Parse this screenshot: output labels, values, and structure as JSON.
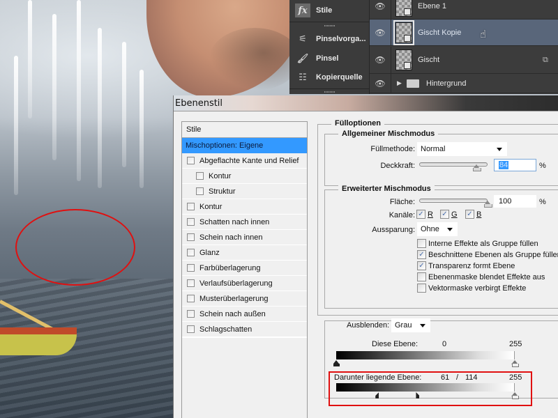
{
  "canvas": {
    "description": "Photo composition: face close-up above stormy sea with water spray and a fishing boat",
    "annotation": "red ellipse highlighting bright spray on water"
  },
  "dock_panels": [
    {
      "label": "Stile",
      "icon": "fx-styles-icon"
    },
    {
      "label": "Pinselvorga...",
      "icon": "brush-presets-icon"
    },
    {
      "label": "Pinsel",
      "icon": "brush-icon"
    },
    {
      "label": "Kopierquelle",
      "icon": "clone-source-icon"
    }
  ],
  "layers": [
    {
      "name": "Ebene 1",
      "visible": true,
      "selected": false,
      "type": "layer"
    },
    {
      "name": "Gischt Kopie",
      "visible": false,
      "selected": true,
      "type": "layer"
    },
    {
      "name": "Gischt",
      "visible": true,
      "selected": false,
      "type": "layer",
      "badge": "smart-object-icon"
    },
    {
      "name": "Hintergrund",
      "visible": true,
      "selected": false,
      "type": "group"
    }
  ],
  "dialog": {
    "title": "Ebenenstil",
    "styles_list": {
      "header": "Stile",
      "active": "Mischoptionen: Eigene",
      "items": [
        {
          "label": "Abgeflachte Kante und Relief",
          "checked": false,
          "sub": false
        },
        {
          "label": "Kontur",
          "checked": false,
          "sub": true
        },
        {
          "label": "Struktur",
          "checked": false,
          "sub": true
        },
        {
          "label": "Kontur",
          "checked": false,
          "sub": false
        },
        {
          "label": "Schatten nach innen",
          "checked": false,
          "sub": false
        },
        {
          "label": "Schein nach innen",
          "checked": false,
          "sub": false
        },
        {
          "label": "Glanz",
          "checked": false,
          "sub": false
        },
        {
          "label": "Farbüberlagerung",
          "checked": false,
          "sub": false
        },
        {
          "label": "Verlaufsüberlagerung",
          "checked": false,
          "sub": false
        },
        {
          "label": "Musterüberlagerung",
          "checked": false,
          "sub": false
        },
        {
          "label": "Schein nach außen",
          "checked": false,
          "sub": false
        },
        {
          "label": "Schlagschatten",
          "checked": false,
          "sub": false
        }
      ]
    },
    "fill_options": {
      "title": "Fülloptionen",
      "general": {
        "title": "Allgemeiner Mischmodus",
        "blend_mode_label": "Füllmethode:",
        "blend_mode_value": "Normal",
        "opacity_label": "Deckkraft:",
        "opacity_value": "84",
        "opacity_unit": "%",
        "opacity_fraction": 0.84
      },
      "advanced": {
        "title": "Erweiterter Mischmodus",
        "fill_label": "Fläche:",
        "fill_value": "100",
        "fill_unit": "%",
        "fill_fraction": 1.0,
        "channels_label": "Kanäle:",
        "channels": [
          {
            "label": "R",
            "checked": true
          },
          {
            "label": "G",
            "checked": true
          },
          {
            "label": "B",
            "checked": true
          }
        ],
        "knockout_label": "Aussparung:",
        "knockout_value": "Ohne",
        "options": [
          {
            "label": "Interne Effekte als Gruppe füllen",
            "checked": false
          },
          {
            "label": "Beschnittene Ebenen als Gruppe füllen",
            "checked": true
          },
          {
            "label": "Transparenz formt Ebene",
            "checked": true
          },
          {
            "label": "Ebenenmaske blendet Effekte aus",
            "checked": false
          },
          {
            "label": "Vektormaske verbirgt Effekte",
            "checked": false
          }
        ]
      },
      "blend_if": {
        "label": "Ausblenden:",
        "value": "Grau",
        "this_layer": {
          "label": "Diese Ebene:",
          "low": "0",
          "high": "255"
        },
        "underlying_layer": {
          "label": "Darunter liegende Ebene:",
          "low": "61",
          "separator": "/",
          "low_split": "114",
          "high": "255"
        }
      }
    }
  }
}
